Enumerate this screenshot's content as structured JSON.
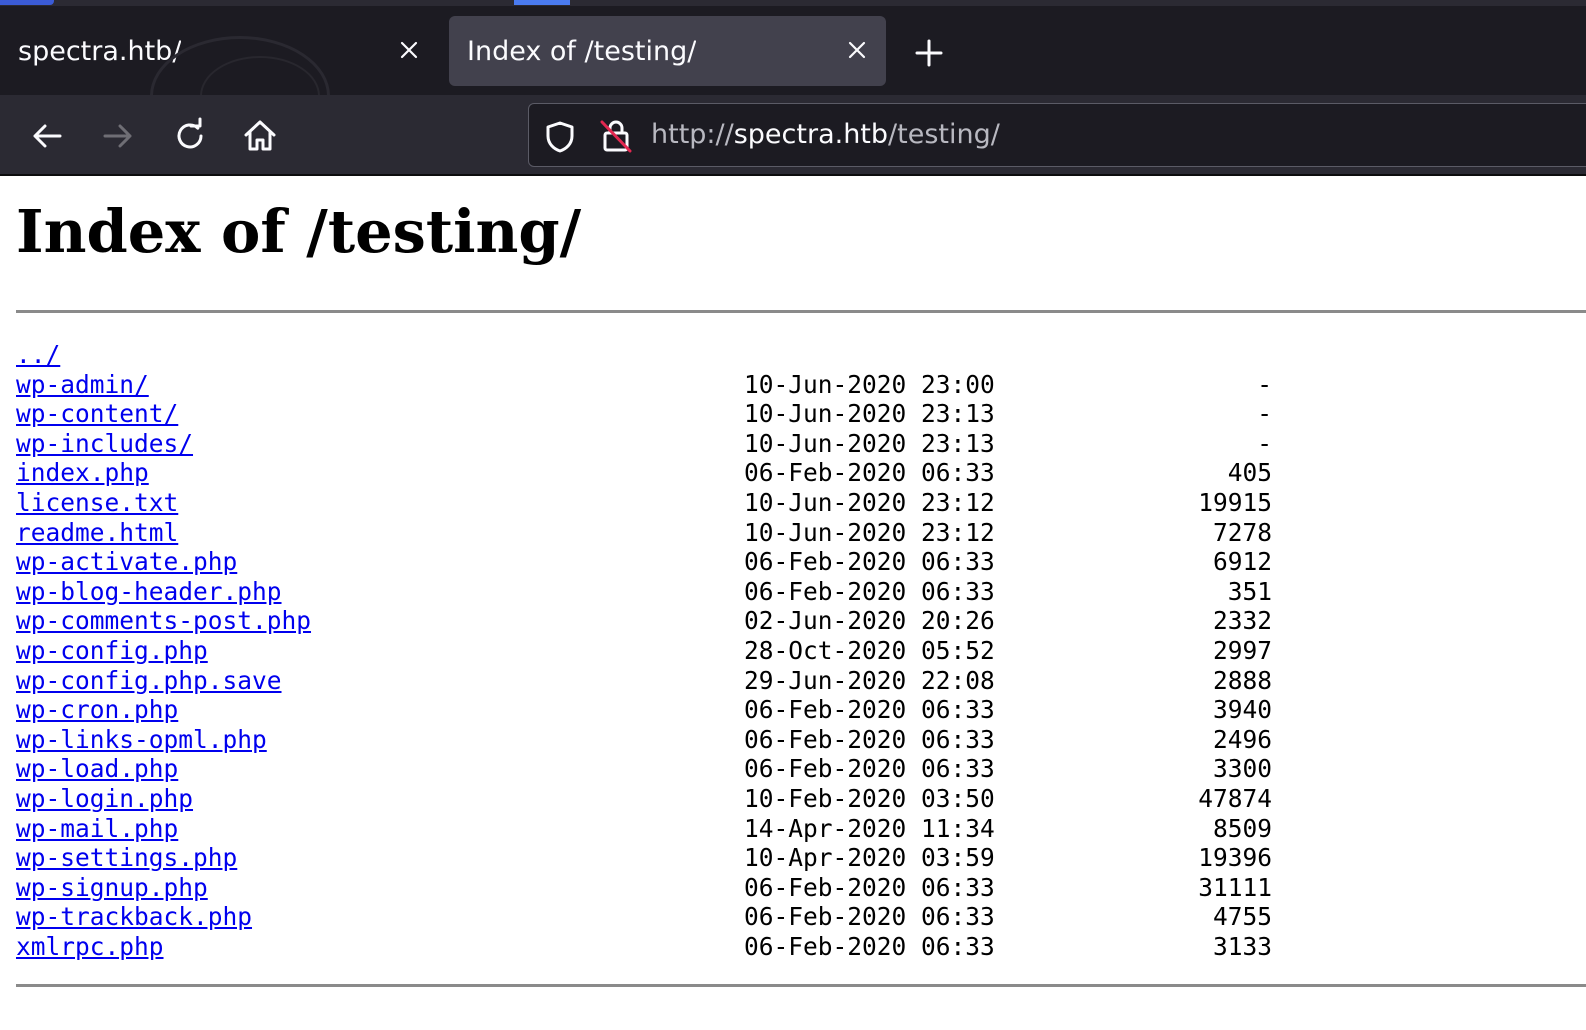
{
  "browser": {
    "tabs": [
      {
        "title": "spectra.htb/",
        "active": false
      },
      {
        "title": "Index of /testing/",
        "active": true
      }
    ],
    "url_scheme": "http://",
    "url_host": "spectra.htb",
    "url_path": "/testing/",
    "icons": {
      "back": "arrow-left-icon",
      "forward": "arrow-right-icon",
      "reload": "reload-icon",
      "home": "home-icon",
      "shield": "shield-icon",
      "insecure_lock": "insecure-lock-icon",
      "new_tab": "plus-icon",
      "close_tab": "close-icon"
    },
    "colors": {
      "tabbar_bg": "#1c1b22",
      "navbar_bg": "#2b2a33",
      "active_tab_bg": "#42414d",
      "link": "#0000ee"
    }
  },
  "page": {
    "heading": "Index of /testing/",
    "entries": [
      {
        "name": "../",
        "date": "",
        "size": ""
      },
      {
        "name": "wp-admin/",
        "date": "10-Jun-2020 23:00",
        "size": "-"
      },
      {
        "name": "wp-content/",
        "date": "10-Jun-2020 23:13",
        "size": "-"
      },
      {
        "name": "wp-includes/",
        "date": "10-Jun-2020 23:13",
        "size": "-"
      },
      {
        "name": "index.php",
        "date": "06-Feb-2020 06:33",
        "size": "405"
      },
      {
        "name": "license.txt",
        "date": "10-Jun-2020 23:12",
        "size": "19915"
      },
      {
        "name": "readme.html",
        "date": "10-Jun-2020 23:12",
        "size": "7278"
      },
      {
        "name": "wp-activate.php",
        "date": "06-Feb-2020 06:33",
        "size": "6912"
      },
      {
        "name": "wp-blog-header.php",
        "date": "06-Feb-2020 06:33",
        "size": "351"
      },
      {
        "name": "wp-comments-post.php",
        "date": "02-Jun-2020 20:26",
        "size": "2332"
      },
      {
        "name": "wp-config.php",
        "date": "28-Oct-2020 05:52",
        "size": "2997"
      },
      {
        "name": "wp-config.php.save",
        "date": "29-Jun-2020 22:08",
        "size": "2888"
      },
      {
        "name": "wp-cron.php",
        "date": "06-Feb-2020 06:33",
        "size": "3940"
      },
      {
        "name": "wp-links-opml.php",
        "date": "06-Feb-2020 06:33",
        "size": "2496"
      },
      {
        "name": "wp-load.php",
        "date": "06-Feb-2020 06:33",
        "size": "3300"
      },
      {
        "name": "wp-login.php",
        "date": "10-Feb-2020 03:50",
        "size": "47874"
      },
      {
        "name": "wp-mail.php",
        "date": "14-Apr-2020 11:34",
        "size": "8509"
      },
      {
        "name": "wp-settings.php",
        "date": "10-Apr-2020 03:59",
        "size": "19396"
      },
      {
        "name": "wp-signup.php",
        "date": "06-Feb-2020 06:33",
        "size": "31111"
      },
      {
        "name": "wp-trackback.php",
        "date": "06-Feb-2020 06:33",
        "size": "4755"
      },
      {
        "name": "xmlrpc.php",
        "date": "06-Feb-2020 06:33",
        "size": "3133"
      }
    ]
  }
}
